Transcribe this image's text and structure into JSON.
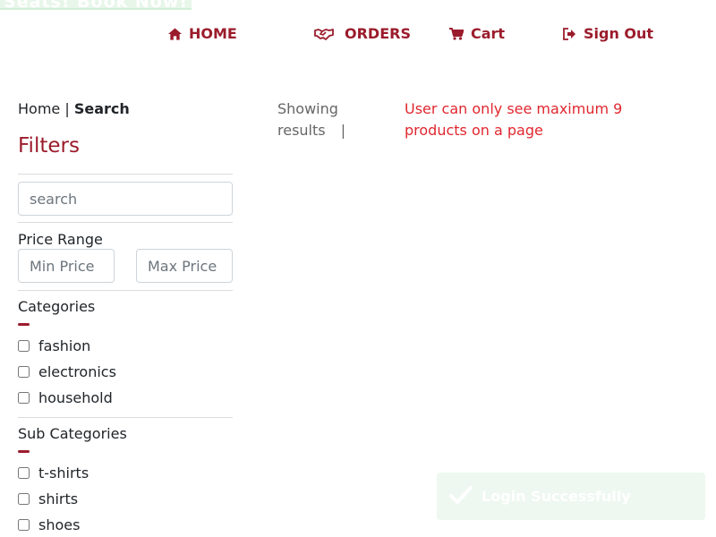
{
  "promo": {
    "text": "Seats! Book Now!"
  },
  "nav": {
    "home": {
      "label": "HOME",
      "icon": "home-icon"
    },
    "orders": {
      "label": "ORDERS",
      "icon": "handshake-icon"
    },
    "cart": {
      "label": "Cart",
      "icon": "cart-icon"
    },
    "signout": {
      "label": "Sign Out",
      "icon": "sign-out-icon"
    }
  },
  "breadcrumb": {
    "home": "Home",
    "separator": "|",
    "current": "Search"
  },
  "filters": {
    "title": "Filters",
    "search_placeholder": "search",
    "price_range": {
      "label": "Price Range",
      "min_placeholder": "Min Price",
      "max_placeholder": "Max Price"
    },
    "categories": {
      "label": "Categories",
      "items": [
        "fashion",
        "electronics",
        "household"
      ]
    },
    "sub_categories": {
      "label": "Sub Categories",
      "items": [
        "t-shirts",
        "shirts",
        "shoes"
      ]
    }
  },
  "results": {
    "showing_label": "Showing results",
    "separator": "|",
    "notice": "User can only see maximum 9 products on a page"
  },
  "toast": {
    "message": "Login Successfully",
    "icon": "check-icon"
  },
  "colors": {
    "brand": "#9b1c2c",
    "notice": "#e0272f",
    "toast_bg": "#eef8f0"
  }
}
